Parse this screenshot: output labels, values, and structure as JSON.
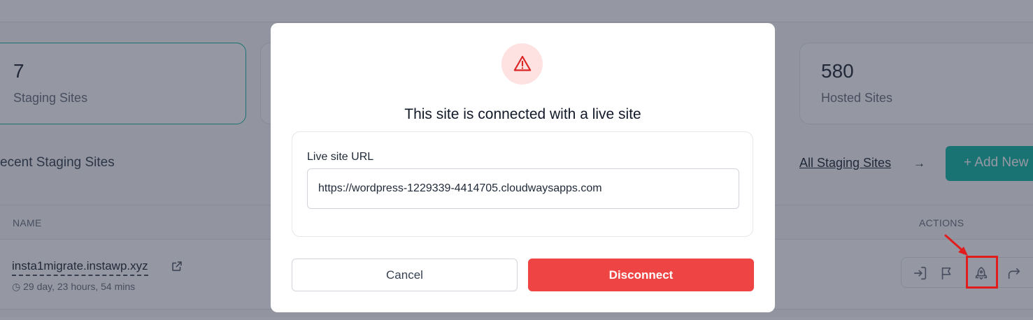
{
  "stats": {
    "staging": {
      "value": "7",
      "label": "Staging Sites"
    },
    "hosted": {
      "value": "580",
      "label": "Hosted Sites"
    }
  },
  "section": {
    "title": "ecent Staging Sites",
    "all_link": "All Staging Sites",
    "all_arrow": "→",
    "add_button": "+ Add New"
  },
  "table": {
    "headers": {
      "name": "NAME",
      "actions": "ACTIONS"
    },
    "rows": [
      {
        "site": "insta1migrate.instawp.xyz",
        "time": "29 day, 23 hours, 54 mins"
      }
    ]
  },
  "modal": {
    "title": "This site is connected with a live site",
    "url_label": "Live site URL",
    "url_value": "https://wordpress-1229339-4414705.cloudwaysapps.com",
    "cancel_label": "Cancel",
    "disconnect_label": "Disconnect"
  },
  "icons": {
    "warning": "warning-triangle-icon",
    "external": "external-link-icon",
    "clock": "clock-icon",
    "login": "login-icon",
    "flag": "flag-icon",
    "deploy": "rocket-icon",
    "forward": "forward-arrow-icon"
  },
  "colors": {
    "accent": "#14b8a6",
    "danger": "#ef4444",
    "warning_bg": "#fee2e2",
    "highlight": "#e11d1d"
  }
}
